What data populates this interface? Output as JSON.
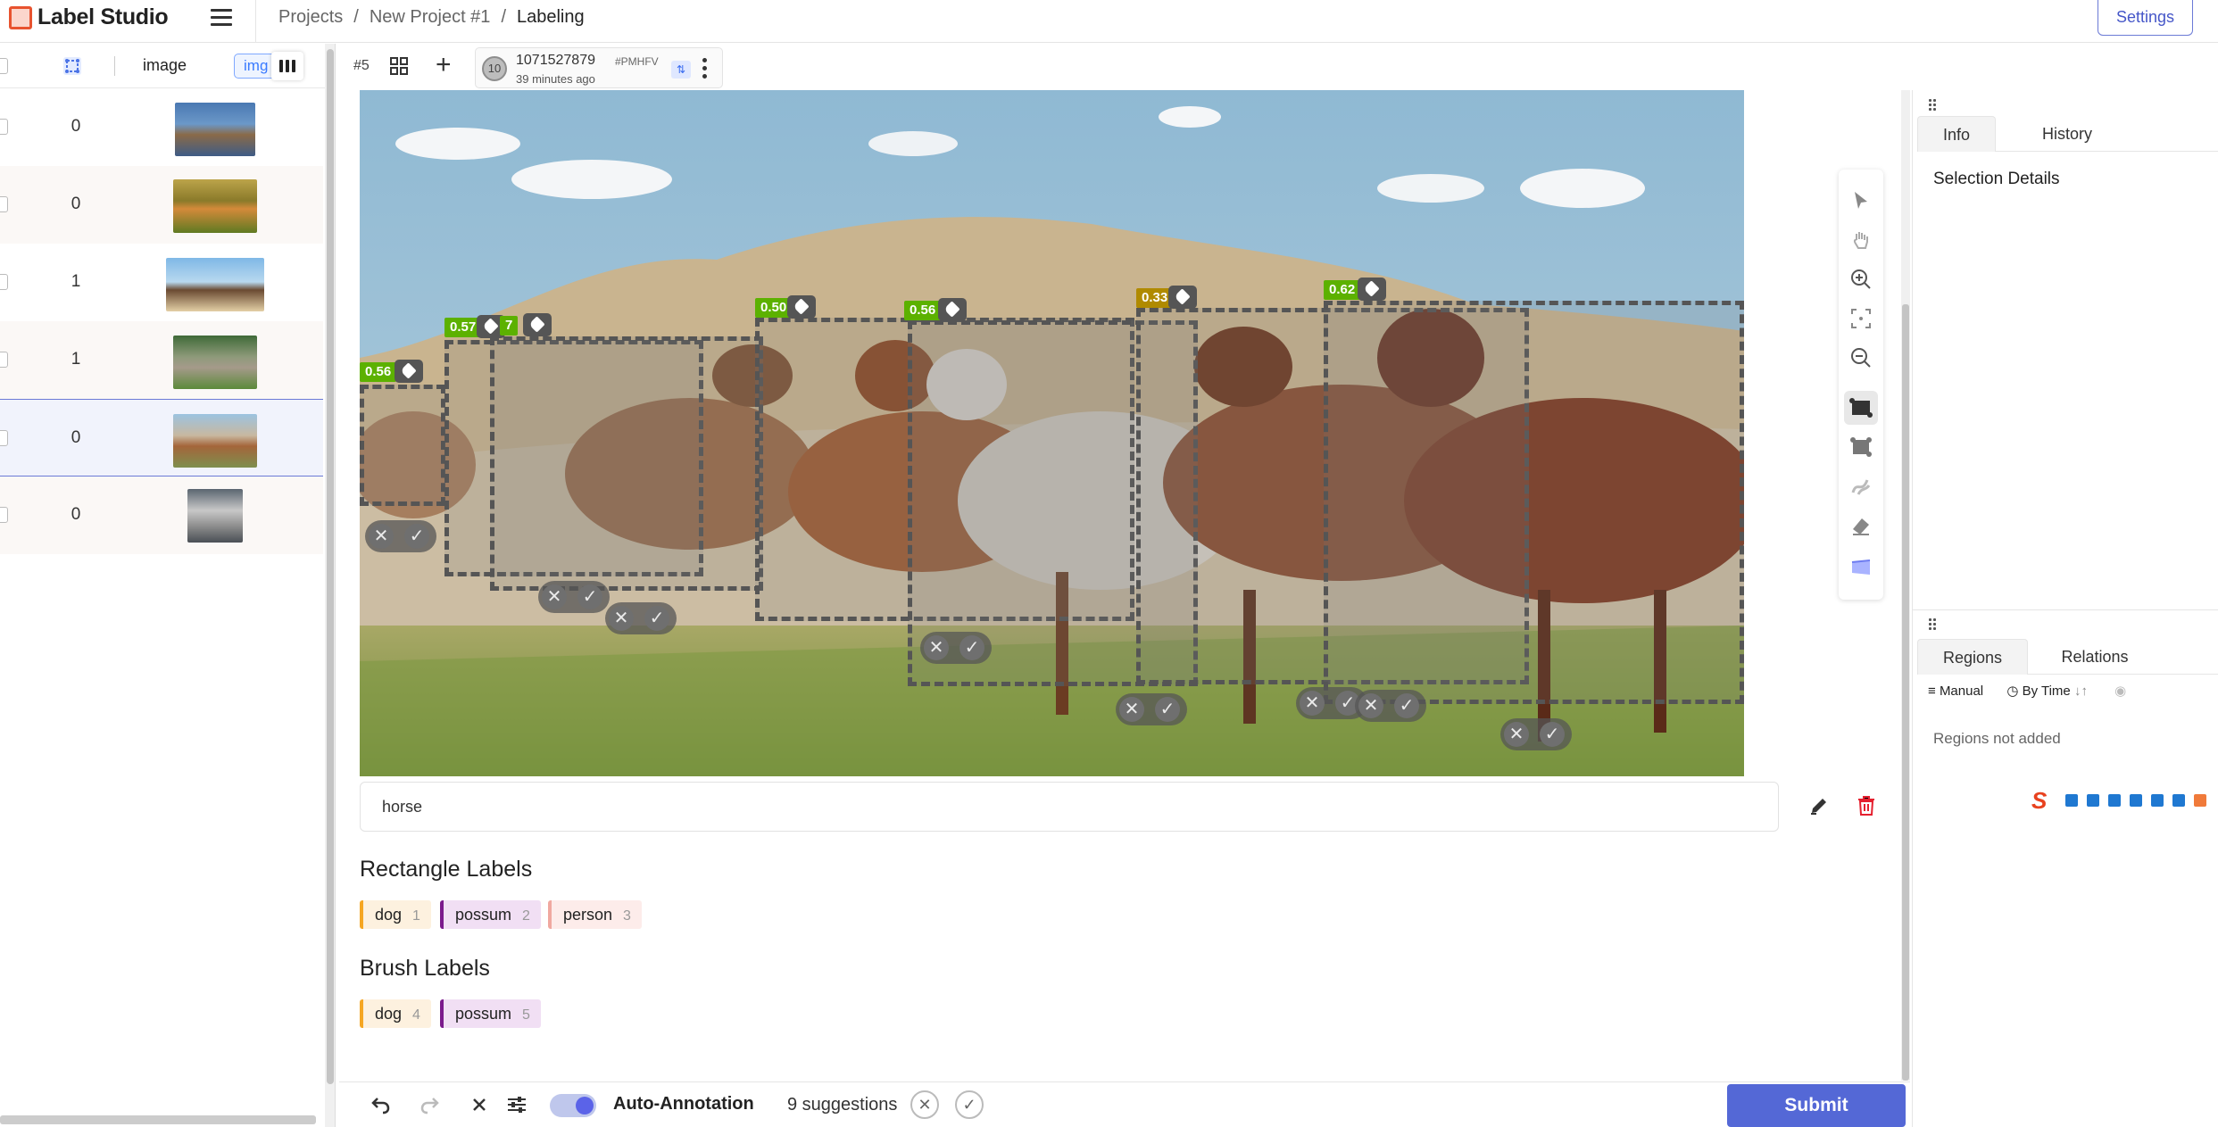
{
  "app": {
    "name": "Label Studio",
    "breadcrumbs": [
      "Projects",
      "New Project #1",
      "Labeling"
    ],
    "settings_label": "Settings"
  },
  "task_list": {
    "columns": {
      "image": "image",
      "img": "img"
    },
    "rows": [
      {
        "value": "0",
        "thumb": "bear"
      },
      {
        "value": "0",
        "thumb": "cow"
      },
      {
        "value": "1",
        "thumb": "horses-beach"
      },
      {
        "value": "1",
        "thumb": "people-park"
      },
      {
        "value": "0",
        "thumb": "horses-run",
        "selected": true
      },
      {
        "value": "0",
        "thumb": "person-door"
      }
    ]
  },
  "annotation": {
    "task_num": "#5",
    "avatar": "10",
    "id": "1071527879",
    "hash": "#PMHFV",
    "time": "39 minutes ago"
  },
  "predictions": [
    {
      "score": "0.56",
      "color": "#5cb100"
    },
    {
      "score": "0.57",
      "color": "#5cb100"
    },
    {
      "score": "7",
      "color": "#5cb100"
    },
    {
      "score": "0.50",
      "color": "#5cb100"
    },
    {
      "score": "0.56",
      "color": "#5cb100"
    },
    {
      "score": "0.33",
      "color": "#b08a00"
    },
    {
      "score": "0.62",
      "color": "#5cb100"
    }
  ],
  "region_text": "horse",
  "rectangle_labels": {
    "title": "Rectangle Labels",
    "items": [
      {
        "label": "dog",
        "hotkey": "1",
        "color": "#f5a623",
        "bg": "#fdf1df"
      },
      {
        "label": "possum",
        "hotkey": "2",
        "color": "#7b1a8c",
        "bg": "#f1dff4"
      },
      {
        "label": "person",
        "hotkey": "3",
        "color": "#f0a8a0",
        "bg": "#fdecea"
      }
    ]
  },
  "brush_labels": {
    "title": "Brush Labels",
    "items": [
      {
        "label": "dog",
        "hotkey": "4",
        "color": "#f5a623",
        "bg": "#fdf1df"
      },
      {
        "label": "possum",
        "hotkey": "5",
        "color": "#7b1a8c",
        "bg": "#f1dff4"
      }
    ]
  },
  "bottom_bar": {
    "auto_annotation": "Auto-Annotation",
    "suggestions": "9 suggestions",
    "submit": "Submit"
  },
  "side_panel": {
    "tabs_top": [
      "Info",
      "History"
    ],
    "selection_details": "Selection Details",
    "tabs_bottom": [
      "Regions",
      "Relations"
    ],
    "manual": "Manual",
    "by_time": "By Time",
    "regions_empty": "Regions not added"
  },
  "colors": {
    "accent": "#5468d6",
    "danger": "#e5202f"
  }
}
